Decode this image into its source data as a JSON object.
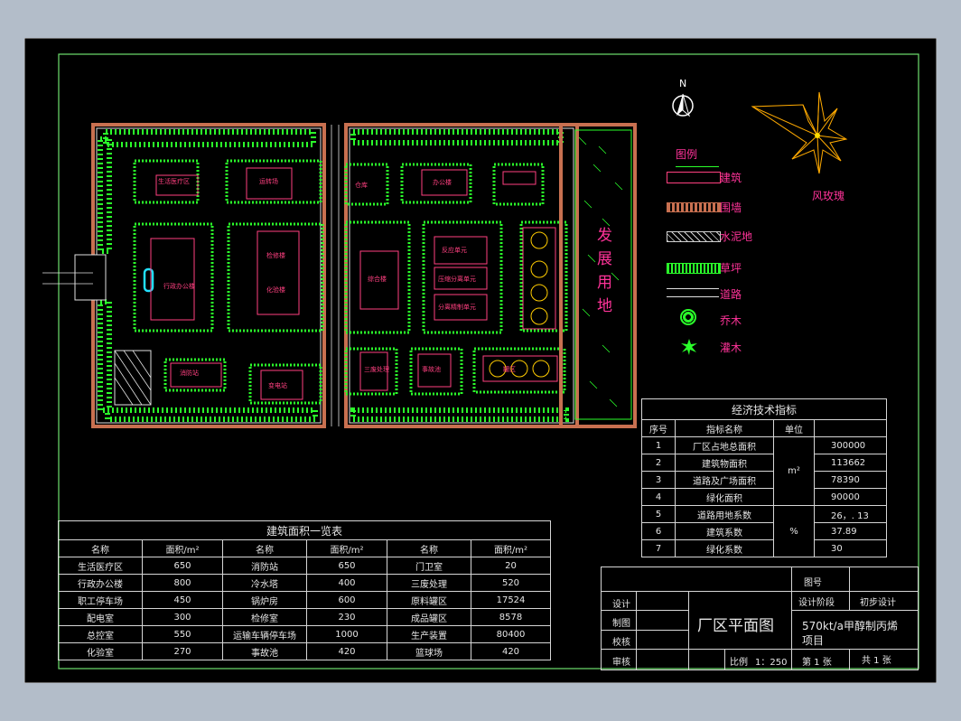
{
  "drawing": {
    "north_label": "N",
    "wind_rose_label": "风玫瑰",
    "development_area_label": [
      "发",
      "展",
      "用",
      "地"
    ],
    "buildings": [
      "生活医疗区",
      "运转场",
      "办公楼",
      "仓库",
      "行政办公楼",
      "检修楼",
      "化验楼",
      "综合楼",
      "反应单元",
      "压缩分离单元",
      "分离精制单元",
      "消防站",
      "变电站",
      "三废处理",
      "事故池",
      "罐区"
    ]
  },
  "legend": {
    "title": "图例",
    "items": [
      {
        "label": "建筑",
        "icon": "building-swatch-icon"
      },
      {
        "label": "围墙",
        "icon": "wall-swatch-icon"
      },
      {
        "label": "水泥地",
        "icon": "cement-swatch-icon"
      },
      {
        "label": "草坪",
        "icon": "lawn-swatch-icon"
      },
      {
        "label": "道路",
        "icon": "road-swatch-icon"
      },
      {
        "label": "乔木",
        "icon": "tree-icon"
      },
      {
        "label": "灌木",
        "icon": "shrub-icon"
      }
    ]
  },
  "econ_table": {
    "title": "经济技术指标",
    "headers": [
      "序号",
      "指标名称",
      "单位",
      ""
    ],
    "rows": [
      {
        "no": "1",
        "name": "厂区占地总面积",
        "value": "300000"
      },
      {
        "no": "2",
        "name": "建筑物面积",
        "value": "113662"
      },
      {
        "no": "3",
        "name": "道路及广场面积",
        "value": "78390"
      },
      {
        "no": "4",
        "name": "绿化面积",
        "value": "90000"
      },
      {
        "no": "5",
        "name": "道路用地系数",
        "value": "26，. 13"
      },
      {
        "no": "6",
        "name": "建筑系数",
        "value": "37.89"
      },
      {
        "no": "7",
        "name": "绿化系数",
        "value": "30"
      }
    ],
    "unit_area": "m²",
    "unit_pct": "%"
  },
  "area_table": {
    "title": "建筑面积一览表",
    "headers": [
      "名称",
      "面积/m²",
      "名称",
      "面积/m²",
      "名称",
      "面积/m²"
    ],
    "rows": [
      [
        "生活医疗区",
        "650",
        "消防站",
        "650",
        "门卫室",
        "20"
      ],
      [
        "行政办公楼",
        "800",
        "冷水塔",
        "400",
        "三废处理",
        "520"
      ],
      [
        "职工停车场",
        "450",
        "锅炉房",
        "600",
        "原料罐区",
        "17524"
      ],
      [
        "配电室",
        "300",
        "检修室",
        "230",
        "成品罐区",
        "8578"
      ],
      [
        "总控室",
        "550",
        "运输车辆停车场",
        "1000",
        "生产装置",
        "80400"
      ],
      [
        "化验室",
        "270",
        "事故池",
        "420",
        "篮球场",
        "420"
      ]
    ]
  },
  "title_block": {
    "drawing_no_label": "图号",
    "design_label": "设计",
    "stage_label": "设计阶段",
    "stage_value": "初步设计",
    "draw_label": "制图",
    "check_label": "校核",
    "review_label": "审核",
    "title": "厂区平面图",
    "project_line1": "570kt/a甲醇制丙烯",
    "project_line2": "项目",
    "scale_label": "比例",
    "scale_value": "1：250",
    "sheet": "第 1 张",
    "total": "共 1 张"
  }
}
